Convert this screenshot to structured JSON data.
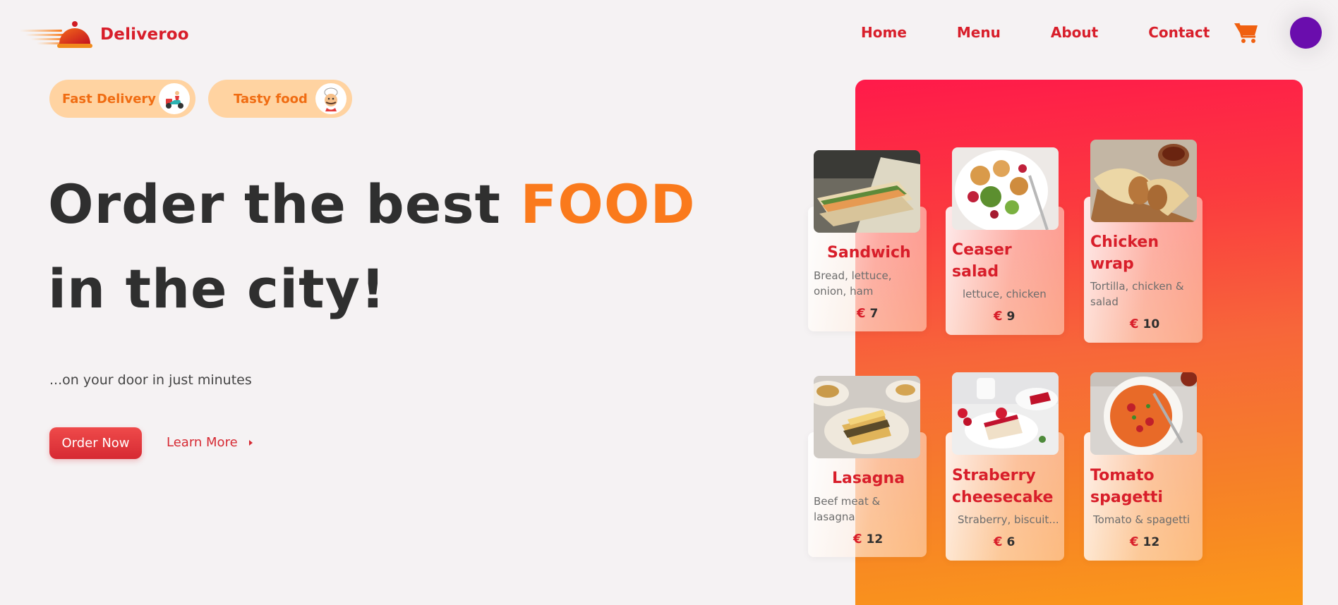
{
  "header": {
    "brand": "Deliveroo",
    "nav": [
      "Home",
      "Menu",
      "About",
      "Contact"
    ],
    "accent_color": "#d81e2a",
    "avatar_color": "#6a0dad"
  },
  "badges": [
    {
      "label": "Fast Delivery",
      "icon": "delivery-scooter-icon"
    },
    {
      "label": "Tasty food",
      "icon": "chef-icon"
    }
  ],
  "hero": {
    "line1_prefix": "Order the best ",
    "line1_accent": "FOOD",
    "line2": "in the city!",
    "subtitle": "...on your door in just minutes",
    "primary_cta": "Order Now",
    "secondary_cta": "Learn More"
  },
  "menu": [
    {
      "name": "Sandwich",
      "description": "Bread, lettuce, onion, ham",
      "currency": "€",
      "price": "7"
    },
    {
      "name": "Ceaser salad",
      "description": "lettuce, chicken",
      "currency": "€",
      "price": "9"
    },
    {
      "name": "Chicken wrap",
      "description": "Tortilla, chicken & salad",
      "currency": "€",
      "price": "10"
    },
    {
      "name": "Lasagna",
      "description": "Beef meat & lasagna",
      "currency": "€",
      "price": "12"
    },
    {
      "name": "Straberry cheesecake",
      "description": "Straberry, biscuit...",
      "currency": "€",
      "price": "6"
    },
    {
      "name": "Tomato spagetti",
      "description": "Tomato & spagetti",
      "currency": "€",
      "price": "12"
    }
  ]
}
